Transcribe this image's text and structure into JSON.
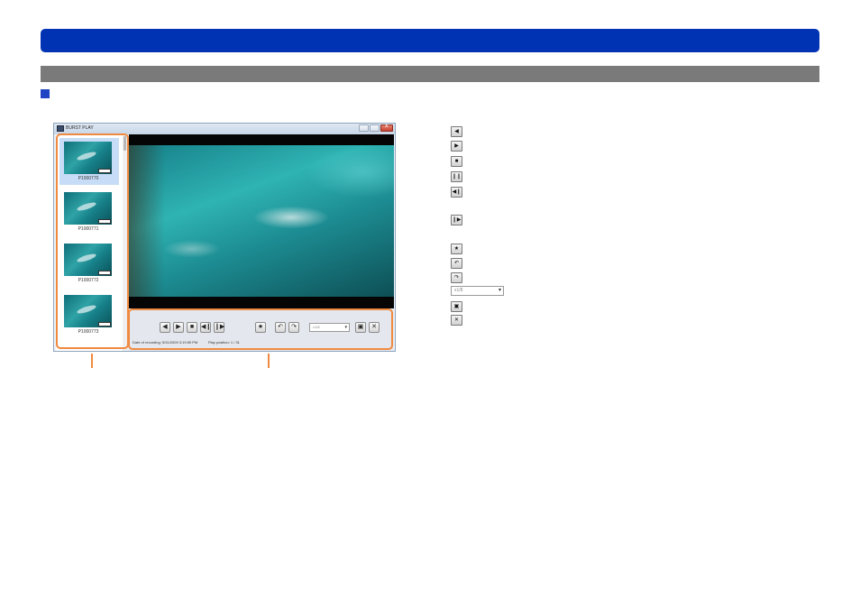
{
  "window": {
    "title": "BURST PLAY"
  },
  "thumbnails": [
    {
      "label": "P1000770",
      "selected": true
    },
    {
      "label": "P1000771",
      "selected": false
    },
    {
      "label": "P1000772",
      "selected": false
    },
    {
      "label": "P1000773",
      "selected": false
    }
  ],
  "controls": {
    "rewind": "◀",
    "play": "▶",
    "stop": "■",
    "frame_back": "◀❙",
    "frame_forward": "❙▶",
    "favorite": "★",
    "rotate_left": "↶",
    "rotate_right": "↷",
    "speed_value": "x1/8",
    "save": "▣",
    "close": "✕"
  },
  "status": {
    "date": "Date of recording: 5/31/2009 3:19:59 PM",
    "position": "Play position: 1 / 31"
  },
  "legend": {
    "icons": [
      {
        "name": "rewind-icon",
        "glyph": "◀"
      },
      {
        "name": "play-icon",
        "glyph": "▶"
      },
      {
        "name": "stop-icon",
        "glyph": "■"
      },
      {
        "name": "pause-icon",
        "glyph": "❙❙"
      },
      {
        "name": "frame-back-icon",
        "glyph": "◀❙"
      },
      {
        "name": "frame-forward-icon",
        "glyph": "❙▶"
      },
      {
        "name": "star-icon",
        "glyph": "★"
      },
      {
        "name": "rotate-left-icon",
        "glyph": "↶"
      },
      {
        "name": "rotate-right-icon",
        "glyph": "↷"
      },
      {
        "name": "save-icon",
        "glyph": "▣"
      },
      {
        "name": "close-icon",
        "glyph": "✕"
      }
    ],
    "speed_value": "x1/8"
  },
  "colors": {
    "title_bar": "#0033b4",
    "section_bar": "#7a7a7a",
    "highlight": "#f08a40"
  }
}
